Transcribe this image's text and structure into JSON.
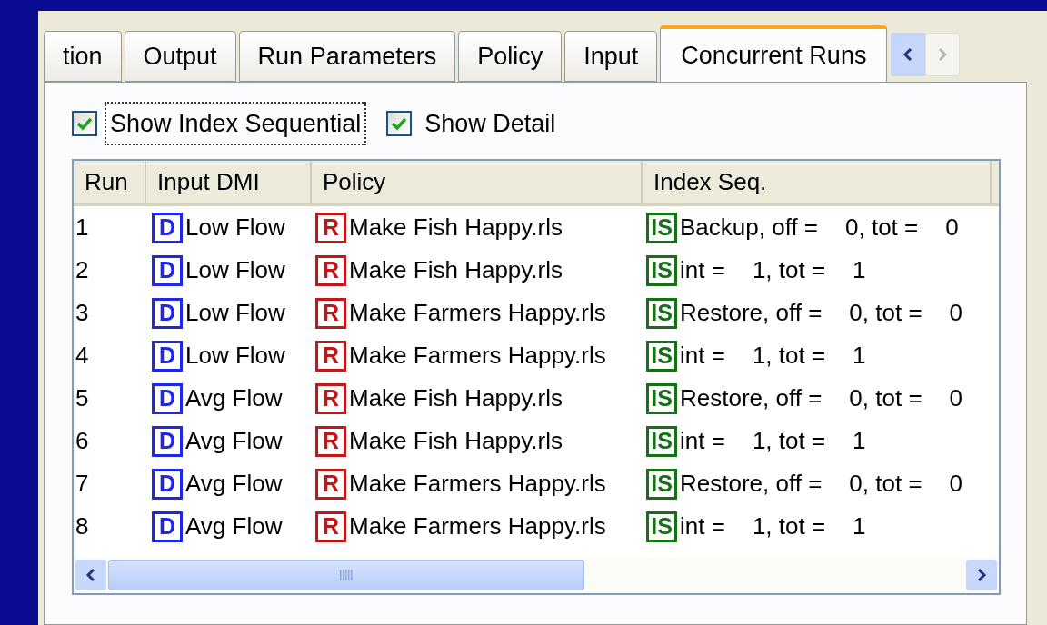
{
  "tabs": [
    {
      "label": "tion",
      "selected": false
    },
    {
      "label": "Output",
      "selected": false
    },
    {
      "label": "Run Parameters",
      "selected": false
    },
    {
      "label": "Policy",
      "selected": false
    },
    {
      "label": "Input",
      "selected": false
    },
    {
      "label": "Concurrent Runs",
      "selected": true
    }
  ],
  "tab_scroll": {
    "back_disabled": false,
    "forward_disabled": true
  },
  "checkboxes": [
    {
      "label": "Show Index Sequential",
      "checked": true,
      "focused": true
    },
    {
      "label": "Show Detail",
      "checked": true,
      "focused": false
    }
  ],
  "table": {
    "columns": [
      "Run",
      "Input DMI",
      "Policy",
      "Index Seq."
    ],
    "rows": [
      {
        "run": "1",
        "input_dmi": {
          "badge": "D",
          "text": "Low Flow"
        },
        "policy": {
          "badge": "R",
          "text": "Make Fish Happy.rls"
        },
        "index_seq": {
          "badge": "IS",
          "label": "Backup, off =",
          "value": "0, tot =",
          "total": "0"
        }
      },
      {
        "run": "2",
        "input_dmi": {
          "badge": "D",
          "text": "Low Flow"
        },
        "policy": {
          "badge": "R",
          "text": "Make Fish Happy.rls"
        },
        "index_seq": {
          "badge": "IS",
          "label": "int =",
          "value": "1, tot =",
          "total": "1"
        }
      },
      {
        "run": "3",
        "input_dmi": {
          "badge": "D",
          "text": "Low Flow"
        },
        "policy": {
          "badge": "R",
          "text": "Make Farmers Happy.rls"
        },
        "index_seq": {
          "badge": "IS",
          "label": "Restore, off =",
          "value": "0, tot =",
          "total": "0"
        }
      },
      {
        "run": "4",
        "input_dmi": {
          "badge": "D",
          "text": "Low Flow"
        },
        "policy": {
          "badge": "R",
          "text": "Make Farmers Happy.rls"
        },
        "index_seq": {
          "badge": "IS",
          "label": "int =",
          "value": "1, tot =",
          "total": "1"
        }
      },
      {
        "run": "5",
        "input_dmi": {
          "badge": "D",
          "text": "Avg Flow"
        },
        "policy": {
          "badge": "R",
          "text": "Make Fish Happy.rls"
        },
        "index_seq": {
          "badge": "IS",
          "label": "Restore, off =",
          "value": "0, tot =",
          "total": "0"
        }
      },
      {
        "run": "6",
        "input_dmi": {
          "badge": "D",
          "text": "Avg Flow"
        },
        "policy": {
          "badge": "R",
          "text": "Make Fish Happy.rls"
        },
        "index_seq": {
          "badge": "IS",
          "label": "int =",
          "value": "1, tot =",
          "total": "1"
        }
      },
      {
        "run": "7",
        "input_dmi": {
          "badge": "D",
          "text": "Avg Flow"
        },
        "policy": {
          "badge": "R",
          "text": "Make Farmers Happy.rls"
        },
        "index_seq": {
          "badge": "IS",
          "label": "Restore, off =",
          "value": "0, tot =",
          "total": "0"
        }
      },
      {
        "run": "8",
        "input_dmi": {
          "badge": "D",
          "text": "Avg Flow"
        },
        "policy": {
          "badge": "R",
          "text": "Make Farmers Happy.rls"
        },
        "index_seq": {
          "badge": "IS",
          "label": "int =",
          "value": "1, tot =",
          "total": "1"
        }
      }
    ]
  }
}
